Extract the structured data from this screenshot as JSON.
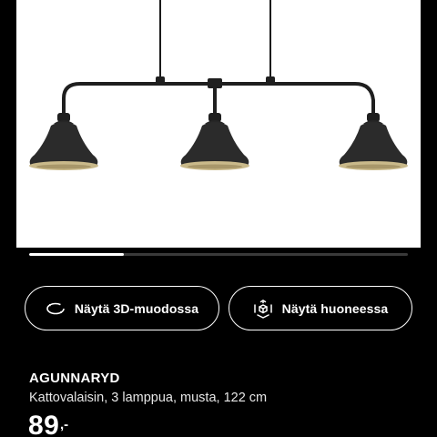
{
  "product_image": {
    "description_icon": "pendant-lamp-3-shades"
  },
  "gallery": {
    "progress_fraction": 0.25
  },
  "actions": {
    "view_3d_label": "Näytä 3D-muodossa",
    "view_3d_icon": "rotate-3d-icon",
    "view_room_label": "Näytä huoneessa",
    "view_room_icon": "ar-cube-icon"
  },
  "product": {
    "name": "AGUNNARYD",
    "description": "Kattovalaisin, 3 lamppua, musta, 122 cm",
    "price": "89",
    "price_suffix": ",-"
  },
  "colors": {
    "background": "#000000",
    "image_background": "#ffffff",
    "lamp_body": "#2b2b2b",
    "lamp_inner": "#c9b98a",
    "text": "#ffffff"
  }
}
